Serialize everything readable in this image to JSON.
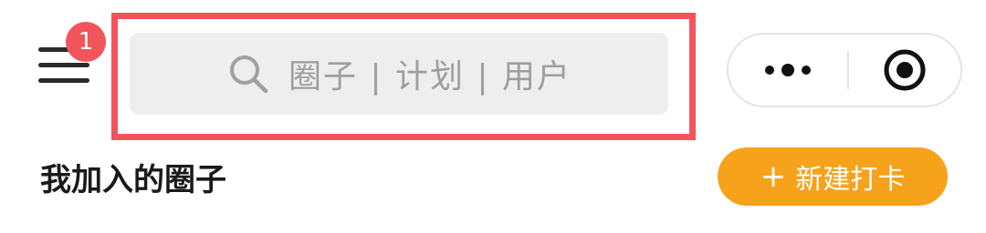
{
  "header": {
    "menu_icon": "hamburger-menu-icon",
    "notification_badge": "1",
    "search": {
      "placeholder": "圈子 | 计划 | 用户",
      "icon": "search-icon"
    },
    "capsule": {
      "more_icon": "more-dots-icon",
      "close_icon": "target-close-icon"
    }
  },
  "section": {
    "title": "我加入的圈子",
    "new_checkin": {
      "plus": "+",
      "label": "新建打卡"
    }
  },
  "colors": {
    "badge": "#f2545b",
    "highlight": "#f2545b",
    "search_bg": "#eeeeee",
    "accent": "#f7a21b"
  }
}
